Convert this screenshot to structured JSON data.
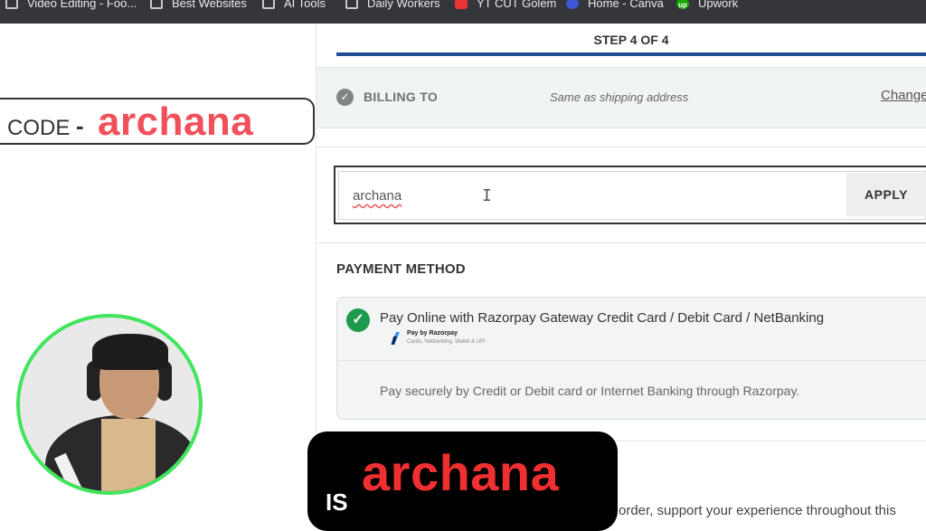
{
  "bookmarks": [
    {
      "label": "Video Editing - Foo...",
      "icon": "folder-icon"
    },
    {
      "label": "Best Websites",
      "icon": "folder-icon"
    },
    {
      "label": "AI Tools",
      "icon": "folder-icon"
    },
    {
      "label": "Daily Workers",
      "icon": "folder-icon"
    },
    {
      "label": "YT CUT Golem",
      "icon": "youtube-icon"
    },
    {
      "label": "Home - Canva",
      "icon": "canva-icon"
    },
    {
      "label": "Upwork",
      "icon": "upwork-icon"
    }
  ],
  "checkout": {
    "step": "STEP 4 OF 4",
    "billing": {
      "label": "BILLING TO",
      "note": "Same as shipping address",
      "change": "Change"
    },
    "coupon": {
      "value": "archana",
      "apply": "APPLY"
    },
    "payment": {
      "title": "PAYMENT METHOD",
      "option_label": "Pay Online with Razorpay Gateway Credit Card / Debit Card / NetBanking",
      "provider_title": "Pay by Razorpay",
      "provider_sub": "Cards, Netbanking, Wallet & UPI",
      "description": "Pay securely by Credit or Debit card or Internet Banking through Razorpay."
    },
    "footer_partial": "order, support your experience throughout this"
  },
  "overlay": {
    "code_label": "CODE",
    "code_dash": "-",
    "code_value": "archana",
    "is_label": "IS",
    "is_value": "archana"
  },
  "colors": {
    "accent_blue": "#1e4b91",
    "success_green": "#1e9a4c",
    "overlay_red": "#f0505a",
    "ring_green": "#41e55c"
  }
}
